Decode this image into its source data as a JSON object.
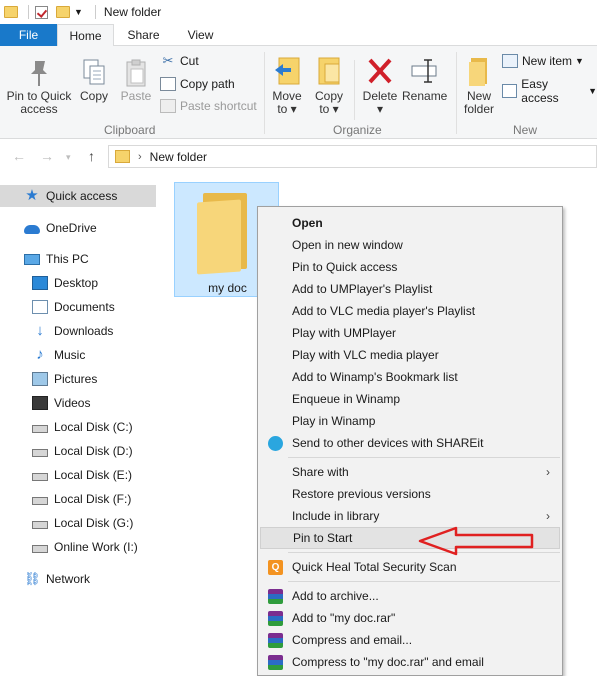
{
  "window": {
    "title": "New folder"
  },
  "tabs": [
    {
      "label": "File"
    },
    {
      "label": "Home"
    },
    {
      "label": "Share"
    },
    {
      "label": "View"
    }
  ],
  "ribbon": {
    "clipboard": {
      "pin_label_1": "Pin to Quick",
      "pin_label_2": "access",
      "copy_label": "Copy",
      "paste_label": "Paste",
      "cut_label": "Cut",
      "copy_path_label": "Copy path",
      "paste_shortcut_label": "Paste shortcut",
      "group_label": "Clipboard"
    },
    "organize": {
      "move_to_1": "Move",
      "move_to_2": "to",
      "copy_to_1": "Copy",
      "copy_to_2": "to",
      "delete_label": "Delete",
      "rename_label": "Rename",
      "group_label": "Organize"
    },
    "new": {
      "new_folder_1": "New",
      "new_folder_2": "folder",
      "new_item_label": "New item",
      "easy_access_label": "Easy access",
      "group_label": "New"
    }
  },
  "address": {
    "path": "New folder"
  },
  "nav": {
    "items": [
      {
        "label": "Quick access",
        "icon": "star-icon"
      },
      {
        "label": "OneDrive",
        "icon": "cloud-icon"
      },
      {
        "label": "This PC",
        "icon": "computer-icon"
      },
      {
        "label": "Desktop",
        "icon": "desktop-icon"
      },
      {
        "label": "Documents",
        "icon": "documents-icon"
      },
      {
        "label": "Downloads",
        "icon": "download-icon"
      },
      {
        "label": "Music",
        "icon": "music-icon"
      },
      {
        "label": "Pictures",
        "icon": "pictures-icon"
      },
      {
        "label": "Videos",
        "icon": "videos-icon"
      },
      {
        "label": "Local Disk (C:)",
        "icon": "disk-icon"
      },
      {
        "label": "Local Disk (D:)",
        "icon": "disk-icon"
      },
      {
        "label": "Local Disk (E:)",
        "icon": "disk-icon"
      },
      {
        "label": "Local Disk (F:)",
        "icon": "disk-icon"
      },
      {
        "label": "Local Disk (G:)",
        "icon": "disk-icon"
      },
      {
        "label": "Online Work (I:)",
        "icon": "disk-icon"
      },
      {
        "label": "Network",
        "icon": "network-icon"
      }
    ]
  },
  "content": {
    "folder_name": "my doc"
  },
  "context_menu": {
    "items": [
      {
        "label": "Open"
      },
      {
        "label": "Open in new window"
      },
      {
        "label": "Pin to Quick access"
      },
      {
        "label": "Add to UMPlayer's Playlist"
      },
      {
        "label": "Add to VLC media player's Playlist"
      },
      {
        "label": "Play with UMPlayer"
      },
      {
        "label": "Play with VLC media player"
      },
      {
        "label": "Add to Winamp's Bookmark list"
      },
      {
        "label": "Enqueue in Winamp"
      },
      {
        "label": "Play in Winamp"
      },
      {
        "label": "Send to other devices with SHAREit"
      },
      {
        "label": "Share with"
      },
      {
        "label": "Restore previous versions"
      },
      {
        "label": "Include in library"
      },
      {
        "label": "Pin to Start"
      },
      {
        "label": "Quick Heal Total Security Scan"
      },
      {
        "label": "Add to archive..."
      },
      {
        "label": "Add to \"my doc.rar\""
      },
      {
        "label": "Compress and email..."
      },
      {
        "label": "Compress to \"my doc.rar\" and email"
      }
    ]
  },
  "colors": {
    "accent": "#1979ca",
    "selection": "#cce8ff",
    "arrow": "#e02020"
  }
}
